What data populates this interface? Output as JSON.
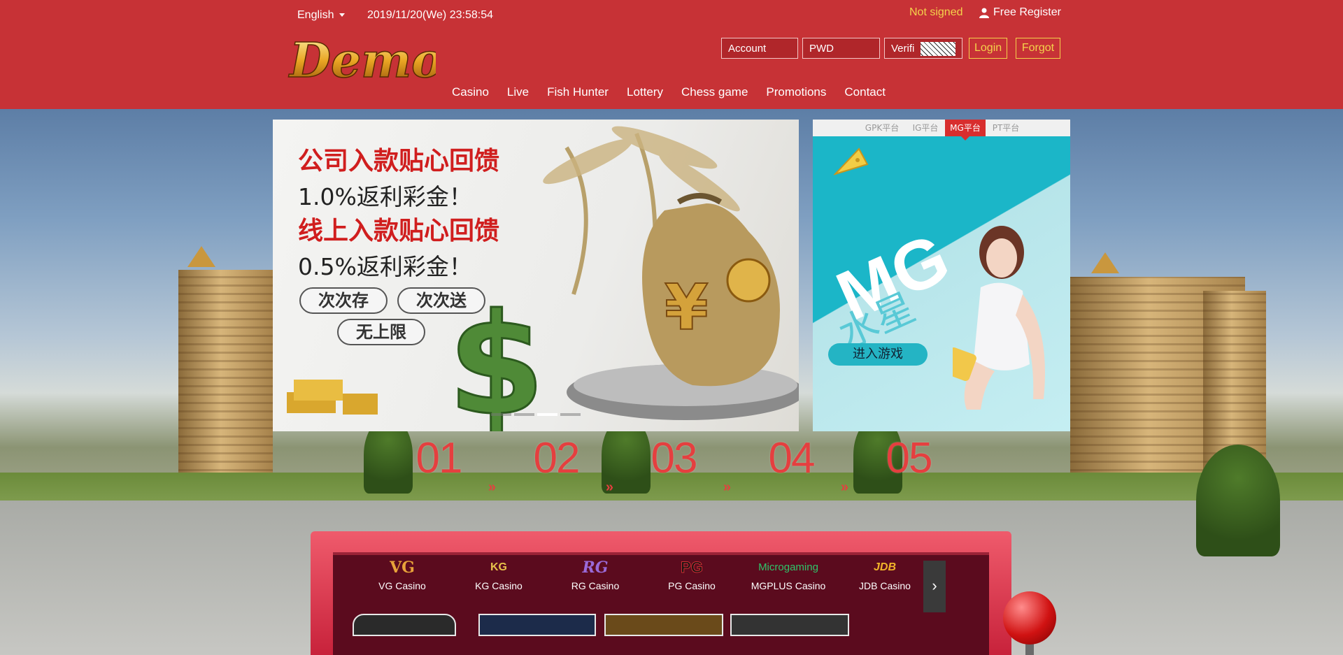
{
  "header": {
    "language": "English",
    "datetime": "2019/11/20(We) 23:58:54",
    "not_signed": "Not signed",
    "register": "Free Register",
    "logo_text": "Demo"
  },
  "login": {
    "account_placeholder": "Account",
    "pwd_placeholder": "PWD",
    "verif_label": "Verifi",
    "login_label": "Login",
    "forgot_label": "Forgot"
  },
  "nav": [
    "Casino",
    "Live",
    "Fish Hunter",
    "Lottery",
    "Chess game",
    "Promotions",
    "Contact"
  ],
  "banner_left": {
    "line1": "公司入款贴心回馈",
    "line2": "1.0%返利彩金！",
    "line3": "线上入款贴心回馈",
    "line4": "0.5%返利彩金！",
    "pills": [
      "次次存",
      "次次送",
      "无上限"
    ]
  },
  "banner_right": {
    "tabs": [
      "GPK平台",
      "IG平台",
      "MG平台",
      "PT平台"
    ],
    "active_tab": "MG平台",
    "title": "MG",
    "cn_title": "水星",
    "enter": "进入游戏"
  },
  "steps": [
    "01",
    "02",
    "03",
    "04",
    "05"
  ],
  "providers": [
    {
      "logo": "VG",
      "name": "VG Casino",
      "color": "#e8a33a"
    },
    {
      "logo": "KG",
      "name": "KG Casino",
      "color": "#e7c24b"
    },
    {
      "logo": "RG",
      "name": "RG Casino",
      "color": "#9a6ad8"
    },
    {
      "logo": "PG",
      "name": "PG Casino",
      "color": "#222222"
    },
    {
      "logo": "Microgaming",
      "name": "MGPLUS Casino",
      "color": "#2fc46a"
    },
    {
      "logo": "JDB",
      "name": "JDB Casino",
      "color": "#f0b42a"
    }
  ],
  "theme": {
    "header_red": "#c73236",
    "gold": "#f4d24b"
  }
}
